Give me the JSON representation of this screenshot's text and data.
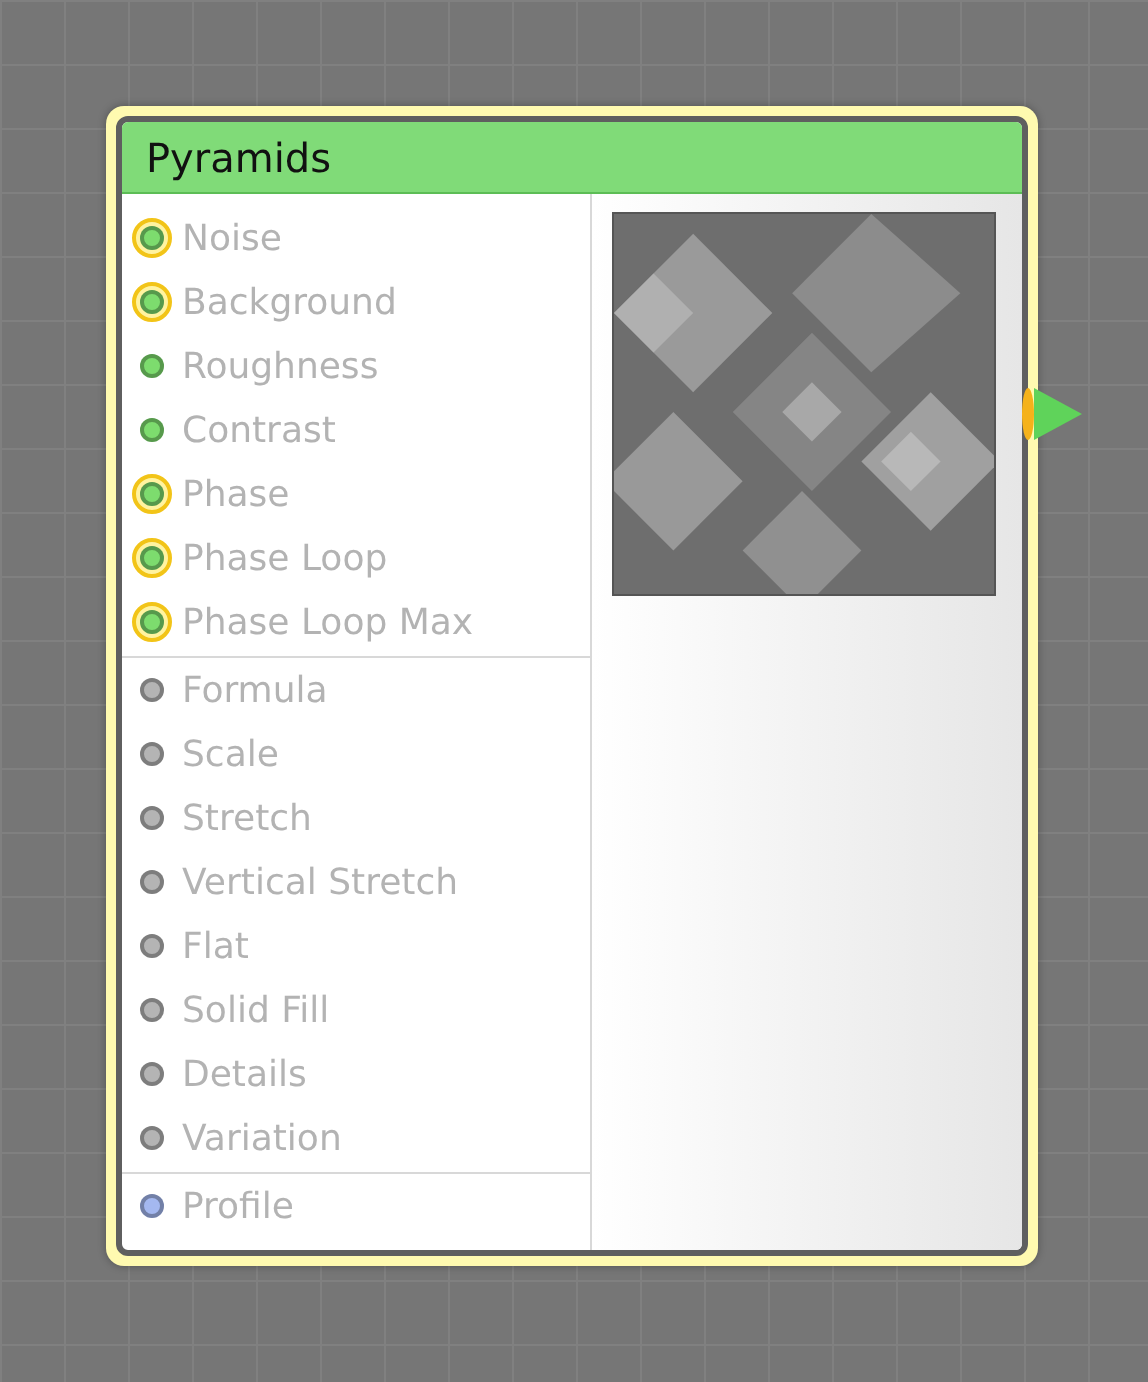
{
  "node": {
    "title": "Pyramids",
    "input_groups": [
      {
        "ports": [
          {
            "label": "Noise",
            "color": "#7ddc6e",
            "linked": true
          },
          {
            "label": "Background",
            "color": "#7ddc6e",
            "linked": true
          },
          {
            "label": "Roughness",
            "color": "#7ddc6e",
            "linked": false
          },
          {
            "label": "Contrast",
            "color": "#7ddc6e",
            "linked": false
          },
          {
            "label": "Phase",
            "color": "#7ddc6e",
            "linked": true
          },
          {
            "label": "Phase Loop",
            "color": "#7ddc6e",
            "linked": true
          },
          {
            "label": "Phase Loop Max",
            "color": "#7ddc6e",
            "linked": true
          }
        ]
      },
      {
        "ports": [
          {
            "label": "Formula",
            "color": "#b4b4b4",
            "linked": false
          },
          {
            "label": "Scale",
            "color": "#b4b4b4",
            "linked": false
          },
          {
            "label": "Stretch",
            "color": "#b4b4b4",
            "linked": false
          },
          {
            "label": "Vertical Stretch",
            "color": "#b4b4b4",
            "linked": false
          },
          {
            "label": "Flat",
            "color": "#b4b4b4",
            "linked": false
          },
          {
            "label": "Solid Fill",
            "color": "#b4b4b4",
            "linked": false
          },
          {
            "label": "Details",
            "color": "#b4b4b4",
            "linked": false
          },
          {
            "label": "Variation",
            "color": "#b4b4b4",
            "linked": false
          }
        ]
      },
      {
        "ports": [
          {
            "label": "Profile",
            "color": "#a4b8f0",
            "linked": false
          }
        ]
      }
    ],
    "output": {
      "color": "#5fd35a",
      "linked": true
    }
  }
}
